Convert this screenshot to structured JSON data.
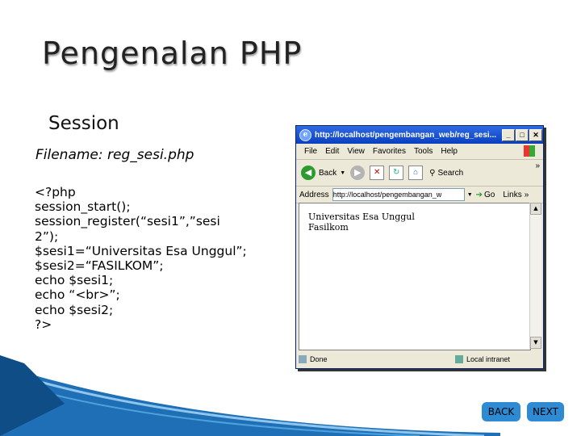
{
  "slide": {
    "title": "Pengenalan PHP",
    "subtitle": "Session",
    "filename_label": "Filename: reg_sesi.php",
    "code_lines": [
      "<?php",
      "session_start();",
      "session_register(“sesi1”,”sesi",
      "2”);",
      "$sesi1=“Universitas Esa Unggul”;",
      "$sesi2=“FASILKOM”;",
      "echo $sesi1;",
      "echo “<br>”;",
      "echo $sesi2;",
      "?>"
    ]
  },
  "browser": {
    "window_title": "http://localhost/pengembangan_web/reg_sesi...",
    "menu": [
      "File",
      "Edit",
      "View",
      "Favorites",
      "Tools",
      "Help"
    ],
    "toolbar": {
      "back": "Back",
      "search": "Search"
    },
    "address_label": "Address",
    "address_value": "http://localhost/pengembangan_w",
    "go_label": "Go",
    "links_label": "Links",
    "content_lines": [
      "Universitas Esa Unggul",
      "Fasilkom"
    ],
    "status_left": "Done",
    "status_right": "Local intranet"
  },
  "nav": {
    "back_label": "BACK",
    "next_label": "NEXT"
  },
  "icons": [
    "ie-icon",
    "minimize-icon",
    "maximize-icon",
    "close-icon",
    "windows-flag-icon",
    "back-arrow-icon",
    "forward-arrow-icon",
    "stop-icon",
    "refresh-icon",
    "home-icon",
    "search-icon"
  ]
}
